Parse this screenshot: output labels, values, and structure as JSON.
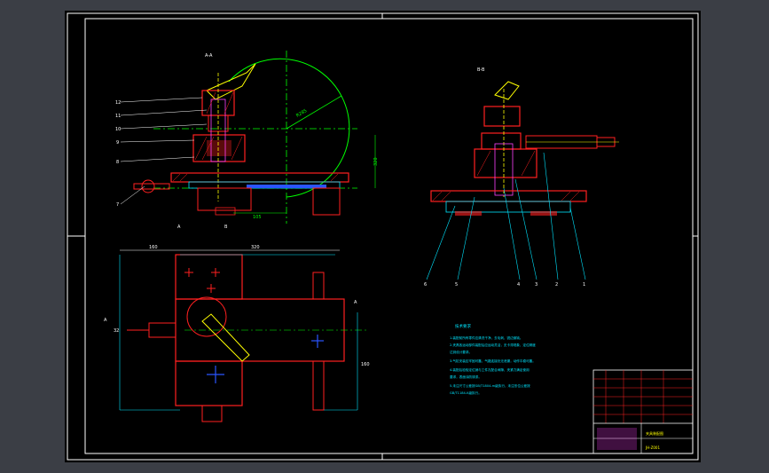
{
  "drawing": {
    "section_labels": {
      "left": "A-A",
      "right": "B-B"
    },
    "dimensions": {
      "top_radius": "R285",
      "top_height": "320",
      "top_bottom": "105",
      "plan_width_a": "160",
      "plan_width_b": "320",
      "plan_left": "32",
      "plan_right": "160"
    },
    "callouts_left": [
      "12",
      "11",
      "10",
      "9",
      "8",
      "7"
    ],
    "callouts_right": [
      "6",
      "5",
      "4",
      "3",
      "2",
      "1"
    ],
    "callouts_bottom": [
      "A",
      "B"
    ],
    "section_marks": {
      "a_left": "A",
      "a_right": "A",
      "b_top": "B",
      "b_bottom": "B"
    },
    "notes_title": "技术要求",
    "notes": [
      "1.装配前所有零件应清洗干净，去毛刺，锐边倒钝。",
      "2.夹具各运动部件装配后应运动灵活，无卡滞现象，定位精度",
      "  达到设计要求。",
      "3.气缸安装应牢固可靠，气路连接处无泄漏，动作平稳可靠。",
      "4.装配后检验定位销与工件孔配合间隙，夹紧力满足使用",
      "  要求，表面涂防锈漆。",
      "5.未注尺寸公差按GB/T1804-m级执行，未注形位公差按",
      "  GB/T1184-K级执行。"
    ],
    "title_block": {
      "name": "夹具装配图",
      "code": "JH-Z001"
    }
  },
  "colors": {
    "red": "#ff2020",
    "green": "#00ff00",
    "cyan": "#00e5ff",
    "white": "#ffffff",
    "yellow": "#ffff00",
    "blue": "#2a55ff",
    "magenta": "#ff40ff",
    "gray": "#8a8a8a"
  }
}
